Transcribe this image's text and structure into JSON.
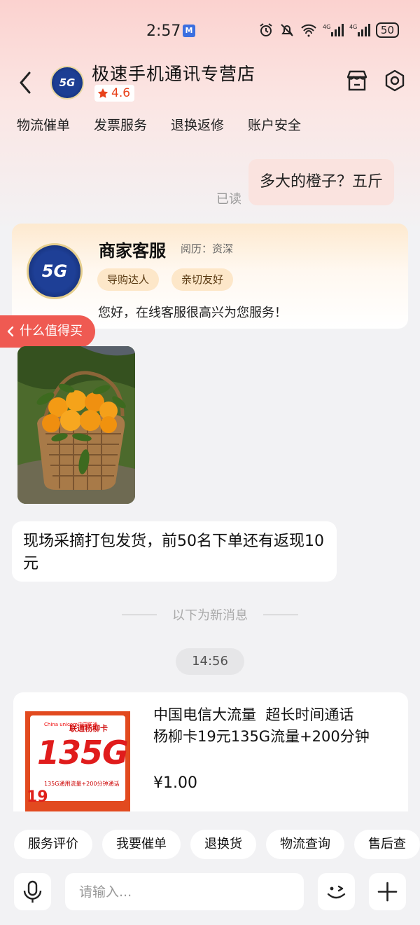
{
  "status_bar": {
    "time": "2:57",
    "notif_badge": "M",
    "battery": "50"
  },
  "header": {
    "shop_name": "极速手机通讯专营店",
    "rating": "4.6",
    "avatar_text": "5G"
  },
  "quick_nav": [
    "物流催单",
    "发票服务",
    "退换返修",
    "账户安全"
  ],
  "messages": {
    "user_message": "多大的橙子？五斤",
    "read_status": "已读",
    "agent": {
      "title": "商家客服",
      "experience": "阅历：资深",
      "tags": [
        "导购达人",
        "亲切友好"
      ],
      "greeting": "您好，在线客服很高兴为您服务！",
      "avatar_text": "5G"
    },
    "worth_buy_label": "什么值得买",
    "text_reply": "现场采摘打包发货，前50名下单还有返现10元",
    "new_messages_label": "以下为新消息",
    "timestamp": "14:56",
    "product": {
      "title": "中国电信大流量  超长时间通话\n杨柳卡19元135G流量+200分钟",
      "price": "¥1.00",
      "image": {
        "brand": "China unicom中国联通",
        "card_name": "联通杨柳卡",
        "big_text": "135G",
        "sub_text": "135G通用流量+200分钟通话",
        "price_badge": "19"
      }
    }
  },
  "quick_replies": [
    "服务评价",
    "我要催单",
    "退换货",
    "物流查询",
    "售后查"
  ],
  "input": {
    "placeholder": "请输入..."
  },
  "colors": {
    "accent_red": "#ef5a52",
    "rating_red": "#e8431c",
    "user_bubble": "#fae3df"
  }
}
